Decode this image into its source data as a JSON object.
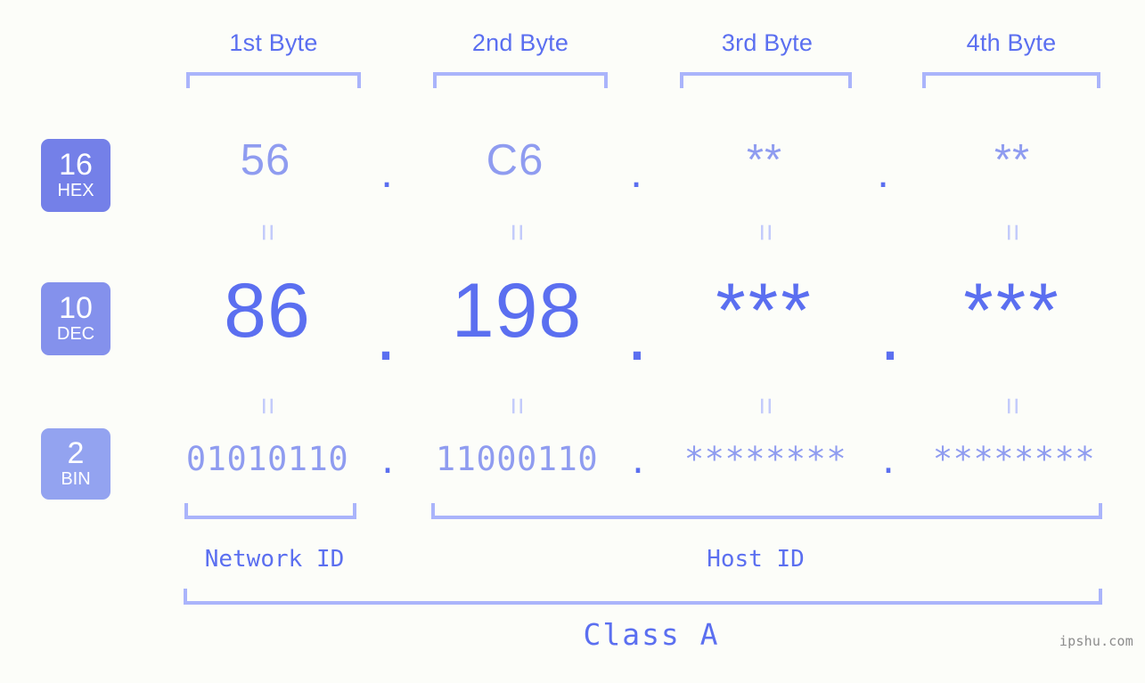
{
  "meta": {
    "background_color": "#fcfdf9",
    "accent_color": "#5b6ff0",
    "accent_light_color": "#8f9cf0",
    "bracket_color": "#aab4fb",
    "connector_color": "#c3cbfb"
  },
  "headers": [
    {
      "label": "1st Byte"
    },
    {
      "label": "2nd Byte"
    },
    {
      "label": "3rd Byte"
    },
    {
      "label": "4th Byte"
    }
  ],
  "bases": [
    {
      "num": "16",
      "abbr": "HEX",
      "color": "#7480e8"
    },
    {
      "num": "10",
      "abbr": "DEC",
      "color": "#8491ec"
    },
    {
      "num": "2",
      "abbr": "BIN",
      "color": "#93a3f0"
    }
  ],
  "rows": {
    "hex": {
      "values": [
        "56",
        "C6",
        "**",
        "**"
      ],
      "separator": "."
    },
    "dec": {
      "values": [
        "86",
        "198",
        "***",
        "***"
      ],
      "separator": "."
    },
    "bin": {
      "values": [
        "01010110",
        "11000110",
        "********",
        "********"
      ],
      "separator": "."
    }
  },
  "connector": "=",
  "sections": [
    {
      "label": "Network ID"
    },
    {
      "label": "Host ID"
    }
  ],
  "class_label": "Class A",
  "watermark": "ipshu.com"
}
